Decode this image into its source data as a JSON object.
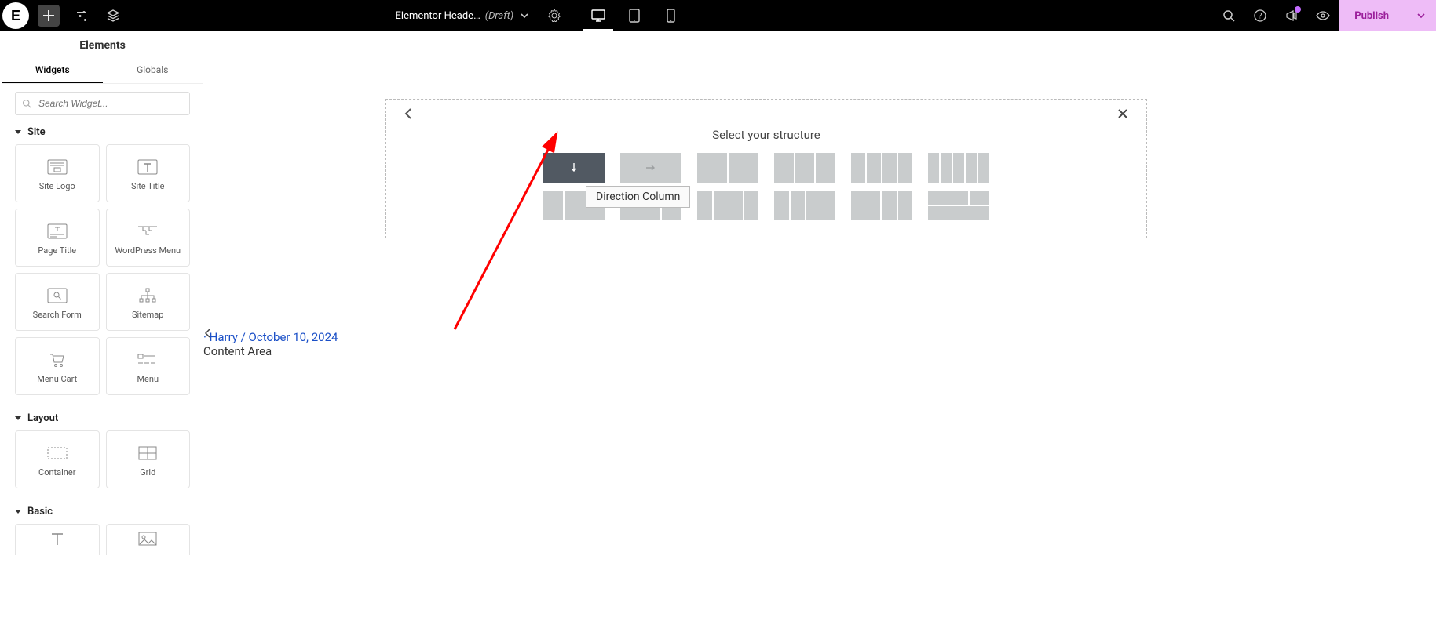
{
  "topbar": {
    "doc_title": "Elementor Heade…",
    "doc_status": "(Draft)",
    "publish_label": "Publish"
  },
  "panel": {
    "title": "Elements",
    "tabs": {
      "widgets": "Widgets",
      "globals": "Globals"
    },
    "search_placeholder": "Search Widget...",
    "sections": {
      "site": "Site",
      "layout": "Layout",
      "basic": "Basic"
    },
    "widgets_site": [
      {
        "label": "Site Logo",
        "icon": "site-logo"
      },
      {
        "label": "Site Title",
        "icon": "site-title"
      },
      {
        "label": "Page Title",
        "icon": "page-title"
      },
      {
        "label": "WordPress Menu",
        "icon": "wp-menu"
      },
      {
        "label": "Search Form",
        "icon": "search-form"
      },
      {
        "label": "Sitemap",
        "icon": "sitemap"
      },
      {
        "label": "Menu Cart",
        "icon": "menu-cart"
      },
      {
        "label": "Menu",
        "icon": "menu"
      }
    ],
    "widgets_layout": [
      {
        "label": "Container",
        "icon": "container"
      },
      {
        "label": "Grid",
        "icon": "grid"
      }
    ]
  },
  "canvas": {
    "byline_prefix": " · Harry / ",
    "byline_date": "October 10, 2024",
    "content_area": "Content Area",
    "structure_title": "Select your structure",
    "tooltip": "Direction Column"
  }
}
